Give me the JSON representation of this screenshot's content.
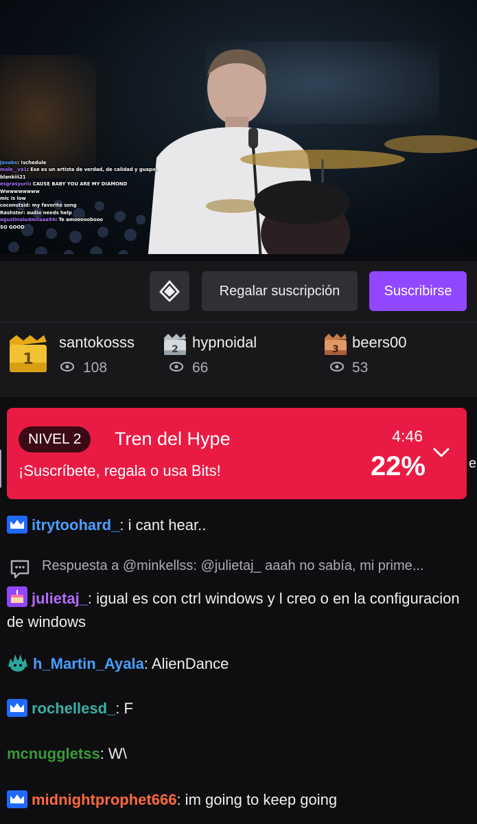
{
  "overlay_chat": [
    {
      "user": "Jaxabs",
      "text": "!schedule",
      "color": "#58a6ff"
    },
    {
      "user": "male__va1",
      "text": "Ese es un artista de verdad, de calidad y guapo.",
      "color": "#a970ff"
    },
    {
      "user": "",
      "text": "",
      "color": "#ffffff"
    },
    {
      "user": "blankiii21",
      "text": "",
      "color": "#ffffff"
    },
    {
      "user": "esgrasyurii",
      "text": "CAUSE BABY YOU ARE MY DIAMOND",
      "color": "#a970ff"
    },
    {
      "user": "",
      "text": "Wwwwwwwww",
      "color": "#ffffff"
    },
    {
      "user": "",
      "text": "mic is low",
      "color": "#a970ff"
    },
    {
      "user": "coconutsid",
      "text": "my favorite song",
      "color": "#ffffff"
    },
    {
      "user": "Rashster",
      "text": "audio needs help",
      "color": "#ffffff"
    },
    {
      "user": "",
      "text": "",
      "color": "#ffffff"
    },
    {
      "user": "agustinaludmilaaa94",
      "text": "Te amooooobooo",
      "color": "#a970ff"
    },
    {
      "user": "",
      "text": "SO GOOD",
      "color": "#ff4f4f"
    },
    {
      "user": "",
      "text": "",
      "color": "#58a6ff"
    }
  ],
  "actions": {
    "gift_label": "Regalar suscripción",
    "subscribe_label": "Suscribirse"
  },
  "leaderboard": [
    {
      "rank": "1",
      "name": "santokosss",
      "count": "108"
    },
    {
      "rank": "2",
      "name": "hypnoidal",
      "count": "66"
    },
    {
      "rank": "3",
      "name": "beers00",
      "count": "53"
    }
  ],
  "hype_train": {
    "level": "NIVEL 2",
    "title": "Tren del Hype",
    "subtitle": "¡Suscríbete, regala o usa Bits!",
    "time": "4:46",
    "percent": "22%"
  },
  "peek_char": "e",
  "chat": {
    "m1": {
      "user": "itrytoohard_",
      "text": ": i cant hear..",
      "color": "#4a9eff"
    },
    "reply": "Respuesta a @minkellss: @julietaj_ aaah no sabía, mi prime...",
    "m2": {
      "user": "julietaj_",
      "text": ":  igual es con  ctrl windows y l creo o en la configuracion de windows",
      "color": "#b36bff"
    },
    "m3": {
      "user": "h_Martin_Ayala",
      "text": ": AlienDance",
      "color": "#4a9eff"
    },
    "m4": {
      "user": "rochellesd_",
      "text": ": F",
      "color": "#3ab0a6"
    },
    "m5": {
      "user": "mcnuggletss",
      "text": ": W\\",
      "color": "#3a9a3a"
    },
    "m6": {
      "user": "midnightprophet666",
      "text": ": im going to keep going",
      "color": "#ff6a3d"
    }
  }
}
